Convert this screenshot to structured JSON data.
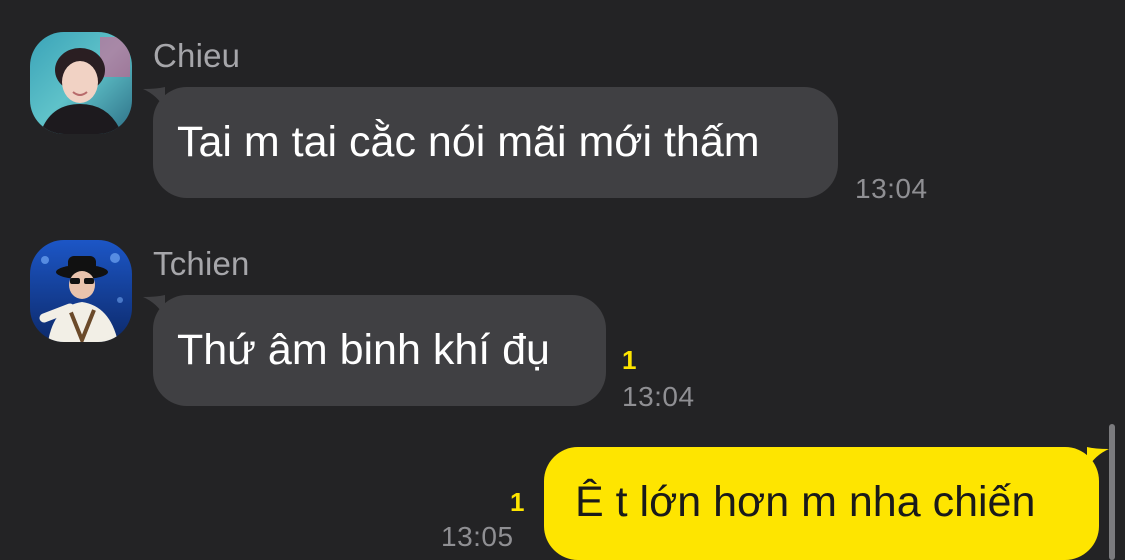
{
  "messages": [
    {
      "sender": "Chieu",
      "text": "Tai m tai cằc nói mãi mới thấm",
      "time": "13:04",
      "unread": ""
    },
    {
      "sender": "Tchien",
      "text": "Thứ âm binh khí đụ",
      "time": "13:04",
      "unread": "1"
    },
    {
      "sender": "",
      "text": "Ê t lớn hơn m nha chiến",
      "time": "13:05",
      "unread": "1"
    }
  ],
  "colors": {
    "background": "#232325",
    "incoming_bubble": "#404043",
    "outgoing_bubble": "#fee500",
    "unread_count": "#fee500"
  },
  "icons": {
    "avatar_chieu": "profile-photo",
    "avatar_tchien": "profile-photo"
  }
}
